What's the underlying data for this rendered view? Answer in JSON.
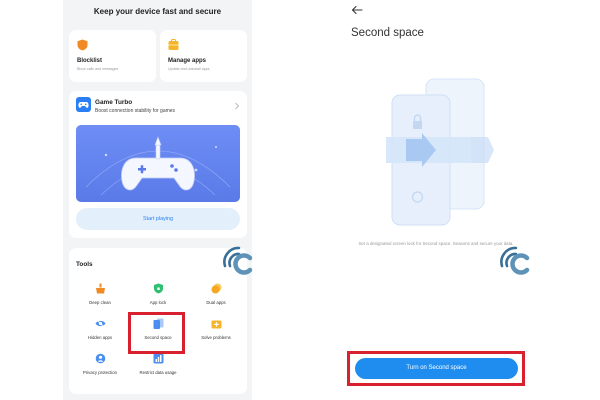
{
  "left_screen": {
    "heading": "Keep your device fast and secure",
    "cards": [
      {
        "title": "Blocklist",
        "subtitle": "Block calls and messages",
        "icon": "shield-icon",
        "color": "#f08a24"
      },
      {
        "title": "Manage apps",
        "subtitle": "Update and uninstall apps",
        "icon": "briefcase-icon",
        "color": "#f5b52a"
      }
    ],
    "game_turbo": {
      "title": "Game Turbo",
      "subtitle": "Boost connection stability for games",
      "button_label": "Start playing",
      "icon": "gamepad-icon",
      "banner_color": "#6684ee"
    },
    "tools": {
      "title": "Tools",
      "items": [
        {
          "label": "Deep clean",
          "icon": "broom-icon",
          "color": "#f08a24"
        },
        {
          "label": "App lock",
          "icon": "lock-shield-icon",
          "color": "#2fbf71"
        },
        {
          "label": "Dual apps",
          "icon": "dual-circle-icon",
          "color": "#f5b52a"
        },
        {
          "label": "Hidden apps",
          "icon": "eye-slash-icon",
          "color": "#4a8ef0"
        },
        {
          "label": "Second space",
          "icon": "second-space-icon",
          "color": "#4a8ef0"
        },
        {
          "label": "Solve problems",
          "icon": "toolbox-icon",
          "color": "#f5b52a"
        },
        {
          "label": "Privacy protection",
          "icon": "privacy-icon",
          "color": "#4a8ef0"
        },
        {
          "label": "Restrict data usage",
          "icon": "data-bars-icon",
          "color": "#4a8ef0"
        }
      ]
    }
  },
  "right_screen": {
    "title": "Second space",
    "description": "Set a designated screen lock for Second space. Seasons and secure your data.",
    "button_label": "Turn on Second space",
    "accent": "#1f8df0"
  },
  "highlight_color": "#d8202f"
}
